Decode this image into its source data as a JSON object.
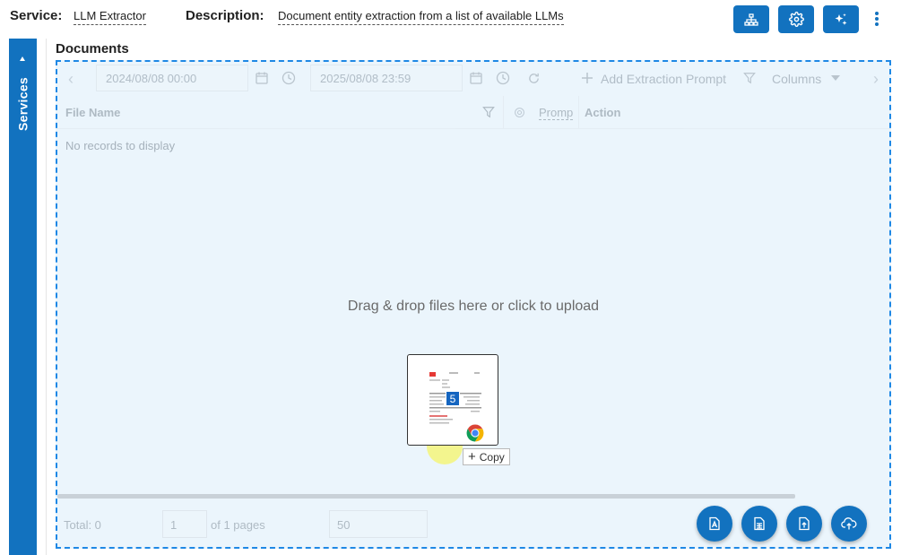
{
  "header": {
    "service_label": "Service:",
    "service_value": "LLM Extractor",
    "description_label": "Description:",
    "description_value": "Document entity extraction from a list of available LLMs",
    "buttons": [
      "hierarchy-icon",
      "settings-icon",
      "ai-sparkle-icon"
    ]
  },
  "sidebar": {
    "label": "Services"
  },
  "documents": {
    "title": "Documents",
    "toolbar": {
      "from_date": "2024/08/08 00:00",
      "to_date": "2025/08/08 23:59",
      "add_prompt": "Add Extraction Prompt",
      "columns": "Columns"
    },
    "grid": {
      "col_file_name": "File Name",
      "col_prompt": "Promp",
      "col_action": "Action",
      "empty": "No records to display"
    },
    "dropzone": "Drag & drop files here or click to upload",
    "footer": {
      "total": "Total: 0",
      "page": "1",
      "of_pages": "of 1 pages",
      "page_size": "50"
    },
    "fab_buttons": [
      "pdf-file-icon",
      "spreadsheet-file-icon",
      "upload-file-icon",
      "cloud-upload-icon"
    ]
  },
  "drag": {
    "count": "5",
    "copy_label": "Copy"
  },
  "colors": {
    "primary": "#1272bf",
    "dropzone_bg": "#ebf5fc",
    "dropzone_border": "#1e88e5"
  }
}
